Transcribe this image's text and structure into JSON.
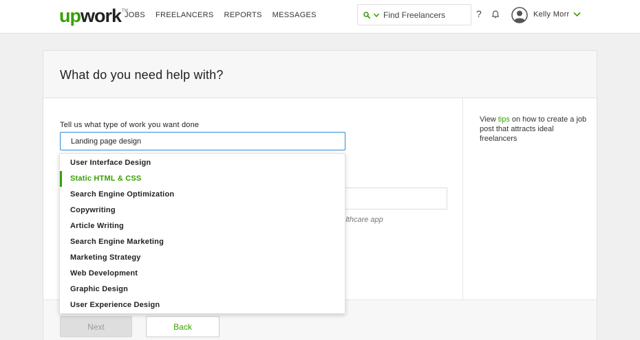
{
  "header": {
    "logo": {
      "up": "up",
      "work": "work",
      "tm": "TM"
    },
    "nav": [
      "JOBS",
      "FREELANCERS",
      "REPORTS",
      "MESSAGES"
    ],
    "search_placeholder": "Find Freelancers",
    "help": "?",
    "user_name": "Kelly Morr"
  },
  "page": {
    "title": "What do you need help with?",
    "work_label": "Tell us what type of work you want done",
    "work_value": "Landing page design",
    "hint_fragment": "healthcare app",
    "tips_pre": "View ",
    "tips_link": "tips",
    "tips_post": " on how to create a job post that attracts ideal freelancers",
    "next_label": "Next",
    "back_label": "Back"
  },
  "dropdown": {
    "items": [
      "User Interface Design",
      "Static HTML & CSS",
      "Search Engine Optimization",
      "Copywriting",
      "Article Writing",
      "Search Engine Marketing",
      "Marketing Strategy",
      "Web Development",
      "Graphic Design",
      "User Experience Design"
    ],
    "active": "Static HTML & CSS"
  },
  "colors": {
    "brand": "#37a000",
    "focus": "#2d8bd1"
  },
  "icons": [
    "search-icon",
    "chevron-down-icon",
    "bell-icon",
    "avatar-icon"
  ]
}
